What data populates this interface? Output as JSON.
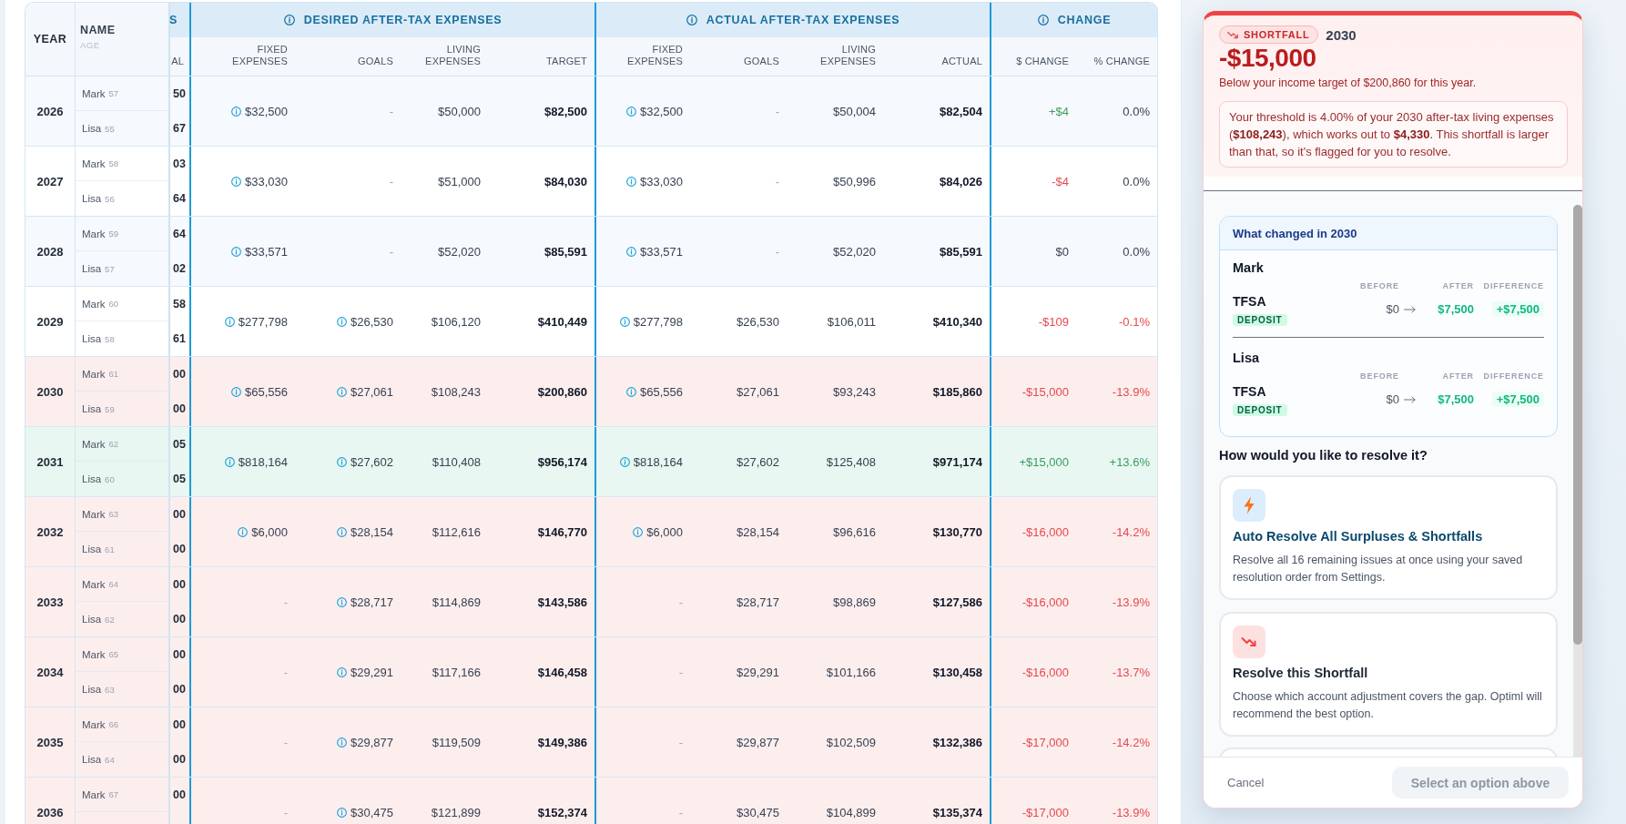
{
  "table": {
    "header": {
      "year": "YEAR",
      "name": "NAME",
      "age": "AGE",
      "column_3": {
        "group": "S",
        "label": "AL"
      },
      "groups": [
        {
          "label": "DESIRED AFTER-TAX EXPENSES",
          "info": true,
          "columns": [
            "FIXED EXPENSES",
            "GOALS",
            "LIVING EXPENSES",
            "TARGET"
          ]
        },
        {
          "label": "ACTUAL AFTER-TAX EXPENSES",
          "info": true,
          "columns": [
            "FIXED EXPENSES",
            "GOALS",
            "LIVING EXPENSES",
            "ACTUAL"
          ]
        },
        {
          "label": "CHANGE",
          "info": true,
          "columns": [
            "$ CHANGE",
            "% CHANGE"
          ]
        }
      ]
    },
    "rows": [
      {
        "year": "2026",
        "color": "#f6f9fd",
        "people": [
          {
            "name": "Mark",
            "age": "57",
            "column_3": "50"
          },
          {
            "name": "Lisa",
            "age": "55",
            "column_3": "67"
          }
        ],
        "desired": {
          "fixed": {
            "text": "$32,500",
            "info": true,
            "muted": false
          },
          "goals": {
            "text": "-",
            "info": false,
            "muted": true
          },
          "living": "$50,000",
          "target": "$82,500"
        },
        "actual": {
          "fixed": {
            "text": "$32,500",
            "info": true,
            "muted": false
          },
          "goals": {
            "text": "-",
            "info": false,
            "muted": true
          },
          "living": "$50,004",
          "actual": "$82,504"
        },
        "change": {
          "amount": {
            "text": "+$4",
            "color": "#3c9d5d"
          },
          "percent": {
            "text": "0.0%",
            "color": "#374151"
          }
        }
      },
      {
        "year": "2027",
        "color": "#ffffff",
        "people": [
          {
            "name": "Mark",
            "age": "58",
            "column_3": "03"
          },
          {
            "name": "Lisa",
            "age": "56",
            "column_3": "64"
          }
        ],
        "desired": {
          "fixed": {
            "text": "$33,030",
            "info": true,
            "muted": false
          },
          "goals": {
            "text": "-",
            "info": false,
            "muted": true
          },
          "living": "$51,000",
          "target": "$84,030"
        },
        "actual": {
          "fixed": {
            "text": "$33,030",
            "info": true,
            "muted": false
          },
          "goals": {
            "text": "-",
            "info": false,
            "muted": true
          },
          "living": "$50,996",
          "actual": "$84,026"
        },
        "change": {
          "amount": {
            "text": "-$4",
            "color": "#e5484d"
          },
          "percent": {
            "text": "0.0%",
            "color": "#374151"
          }
        }
      },
      {
        "year": "2028",
        "color": "#f6f9fd",
        "people": [
          {
            "name": "Mark",
            "age": "59",
            "column_3": "64"
          },
          {
            "name": "Lisa",
            "age": "57",
            "column_3": "02"
          }
        ],
        "desired": {
          "fixed": {
            "text": "$33,571",
            "info": true,
            "muted": false
          },
          "goals": {
            "text": "-",
            "info": false,
            "muted": true
          },
          "living": "$52,020",
          "target": "$85,591"
        },
        "actual": {
          "fixed": {
            "text": "$33,571",
            "info": true,
            "muted": false
          },
          "goals": {
            "text": "-",
            "info": false,
            "muted": true
          },
          "living": "$52,020",
          "actual": "$85,591"
        },
        "change": {
          "amount": {
            "text": "$0",
            "color": "#374151"
          },
          "percent": {
            "text": "0.0%",
            "color": "#374151"
          }
        }
      },
      {
        "year": "2029",
        "color": "#ffffff",
        "people": [
          {
            "name": "Mark",
            "age": "60",
            "column_3": "58"
          },
          {
            "name": "Lisa",
            "age": "58",
            "column_3": "61"
          }
        ],
        "desired": {
          "fixed": {
            "text": "$277,798",
            "info": true,
            "muted": false
          },
          "goals": {
            "text": "$26,530",
            "info": true,
            "muted": false
          },
          "living": "$106,120",
          "target": "$410,449"
        },
        "actual": {
          "fixed": {
            "text": "$277,798",
            "info": true,
            "muted": false
          },
          "goals": {
            "text": "$26,530",
            "info": false,
            "muted": false
          },
          "living": "$106,011",
          "actual": "$410,340"
        },
        "change": {
          "amount": {
            "text": "-$109",
            "color": "#e5484d"
          },
          "percent": {
            "text": "-0.1%",
            "color": "#e5484d"
          }
        }
      },
      {
        "year": "2030",
        "color": "#fdeeee",
        "people": [
          {
            "name": "Mark",
            "age": "61",
            "column_3": "00"
          },
          {
            "name": "Lisa",
            "age": "59",
            "column_3": "00"
          }
        ],
        "desired": {
          "fixed": {
            "text": "$65,556",
            "info": true,
            "muted": false
          },
          "goals": {
            "text": "$27,061",
            "info": true,
            "muted": false
          },
          "living": "$108,243",
          "target": "$200,860"
        },
        "actual": {
          "fixed": {
            "text": "$65,556",
            "info": true,
            "muted": false
          },
          "goals": {
            "text": "$27,061",
            "info": false,
            "muted": false
          },
          "living": "$93,243",
          "actual": "$185,860"
        },
        "change": {
          "amount": {
            "text": "-$15,000",
            "color": "#e5484d"
          },
          "percent": {
            "text": "-13.9%",
            "color": "#e5484d"
          }
        }
      },
      {
        "year": "2031",
        "color": "#e8f7f1",
        "people": [
          {
            "name": "Mark",
            "age": "62",
            "column_3": "05"
          },
          {
            "name": "Lisa",
            "age": "60",
            "column_3": "05"
          }
        ],
        "desired": {
          "fixed": {
            "text": "$818,164",
            "info": true,
            "muted": false
          },
          "goals": {
            "text": "$27,602",
            "info": true,
            "muted": false
          },
          "living": "$110,408",
          "target": "$956,174"
        },
        "actual": {
          "fixed": {
            "text": "$818,164",
            "info": true,
            "muted": false
          },
          "goals": {
            "text": "$27,602",
            "info": false,
            "muted": false
          },
          "living": "$125,408",
          "actual": "$971,174"
        },
        "change": {
          "amount": {
            "text": "+$15,000",
            "color": "#3c9d5d"
          },
          "percent": {
            "text": "+13.6%",
            "color": "#3c9d5d"
          }
        }
      },
      {
        "year": "2032",
        "color": "#fdeeee",
        "people": [
          {
            "name": "Mark",
            "age": "63",
            "column_3": "00"
          },
          {
            "name": "Lisa",
            "age": "61",
            "column_3": "00"
          }
        ],
        "desired": {
          "fixed": {
            "text": "$6,000",
            "info": true,
            "muted": false
          },
          "goals": {
            "text": "$28,154",
            "info": true,
            "muted": false
          },
          "living": "$112,616",
          "target": "$146,770"
        },
        "actual": {
          "fixed": {
            "text": "$6,000",
            "info": true,
            "muted": false
          },
          "goals": {
            "text": "$28,154",
            "info": false,
            "muted": false
          },
          "living": "$96,616",
          "actual": "$130,770"
        },
        "change": {
          "amount": {
            "text": "-$16,000",
            "color": "#e5484d"
          },
          "percent": {
            "text": "-14.2%",
            "color": "#e5484d"
          }
        }
      },
      {
        "year": "2033",
        "color": "#fdeeee",
        "people": [
          {
            "name": "Mark",
            "age": "64",
            "column_3": "00"
          },
          {
            "name": "Lisa",
            "age": "62",
            "column_3": "00"
          }
        ],
        "desired": {
          "fixed": {
            "text": "-",
            "info": false,
            "muted": true
          },
          "goals": {
            "text": "$28,717",
            "info": true,
            "muted": false
          },
          "living": "$114,869",
          "target": "$143,586"
        },
        "actual": {
          "fixed": {
            "text": "-",
            "info": false,
            "muted": true
          },
          "goals": {
            "text": "$28,717",
            "info": false,
            "muted": false
          },
          "living": "$98,869",
          "actual": "$127,586"
        },
        "change": {
          "amount": {
            "text": "-$16,000",
            "color": "#e5484d"
          },
          "percent": {
            "text": "-13.9%",
            "color": "#e5484d"
          }
        }
      },
      {
        "year": "2034",
        "color": "#fdeeee",
        "people": [
          {
            "name": "Mark",
            "age": "65",
            "column_3": "00"
          },
          {
            "name": "Lisa",
            "age": "63",
            "column_3": "00"
          }
        ],
        "desired": {
          "fixed": {
            "text": "-",
            "info": false,
            "muted": true
          },
          "goals": {
            "text": "$29,291",
            "info": true,
            "muted": false
          },
          "living": "$117,166",
          "target": "$146,458"
        },
        "actual": {
          "fixed": {
            "text": "-",
            "info": false,
            "muted": true
          },
          "goals": {
            "text": "$29,291",
            "info": false,
            "muted": false
          },
          "living": "$101,166",
          "actual": "$130,458"
        },
        "change": {
          "amount": {
            "text": "-$16,000",
            "color": "#e5484d"
          },
          "percent": {
            "text": "-13.7%",
            "color": "#e5484d"
          }
        }
      },
      {
        "year": "2035",
        "color": "#fdeeee",
        "people": [
          {
            "name": "Mark",
            "age": "66",
            "column_3": "00"
          },
          {
            "name": "Lisa",
            "age": "64",
            "column_3": "00"
          }
        ],
        "desired": {
          "fixed": {
            "text": "-",
            "info": false,
            "muted": true
          },
          "goals": {
            "text": "$29,877",
            "info": true,
            "muted": false
          },
          "living": "$119,509",
          "target": "$149,386"
        },
        "actual": {
          "fixed": {
            "text": "-",
            "info": false,
            "muted": true
          },
          "goals": {
            "text": "$29,877",
            "info": false,
            "muted": false
          },
          "living": "$102,509",
          "actual": "$132,386"
        },
        "change": {
          "amount": {
            "text": "-$17,000",
            "color": "#e5484d"
          },
          "percent": {
            "text": "-14.2%",
            "color": "#e5484d"
          }
        }
      },
      {
        "year": "2036",
        "color": "#fdeeee",
        "people": [
          {
            "name": "Mark",
            "age": "67",
            "column_3": "00"
          }
        ],
        "desired": {
          "fixed": {
            "text": "-",
            "info": false,
            "muted": true
          },
          "goals": {
            "text": "$30,475",
            "info": true,
            "muted": false
          },
          "living": "$121,899",
          "target": "$152,374"
        },
        "actual": {
          "fixed": {
            "text": "-",
            "info": false,
            "muted": true
          },
          "goals": {
            "text": "$30,475",
            "info": false,
            "muted": false
          },
          "living": "$104,899",
          "actual": "$135,374"
        },
        "change": {
          "amount": {
            "text": "-$17,000",
            "color": "#e5484d"
          },
          "percent": {
            "text": "-13.9%",
            "color": "#e5484d"
          }
        }
      }
    ]
  },
  "panel": {
    "badge": "SHORTFALL",
    "year": "2030",
    "amount": "-$15,000",
    "subtitle": "Below your income target of $200,860 for this year.",
    "threshold_note": "Your threshold is 4.00% of your 2030 after-tax living expenses (**$108,243**), which works out to **$4,330**. This shortfall is larger than that, so it's flagged for you to resolve.",
    "changes": {
      "title": "What changed in 2030",
      "people": [
        {
          "name": "Mark",
          "columns": [
            "BEFORE",
            "AFTER",
            "DIFFERENCE"
          ],
          "accounts": [
            {
              "name": "TFSA",
              "tag": "DEPOSIT",
              "before": "$0",
              "after": "$7,500",
              "difference": "+$7,500"
            }
          ]
        },
        {
          "name": "Lisa",
          "columns": [
            "BEFORE",
            "AFTER",
            "DIFFERENCE"
          ],
          "accounts": [
            {
              "name": "TFSA",
              "tag": "DEPOSIT",
              "before": "$0",
              "after": "$7,500",
              "difference": "+$7,500"
            }
          ]
        }
      ]
    },
    "question": "How would you like to resolve it?",
    "options": [
      {
        "kind": "auto",
        "title": "Auto Resolve All Surpluses & Shortfalls",
        "description": "Resolve all 16 remaining issues at once using your saved resolution order from Settings."
      },
      {
        "kind": "shortfall",
        "title": "Resolve this Shortfall",
        "description": "Choose which account adjustment covers the gap. Optiml will recommend the best option."
      }
    ],
    "footer": {
      "cancel": "Cancel",
      "confirm": {
        "label": "Select an option above",
        "disabled": true
      }
    }
  }
}
